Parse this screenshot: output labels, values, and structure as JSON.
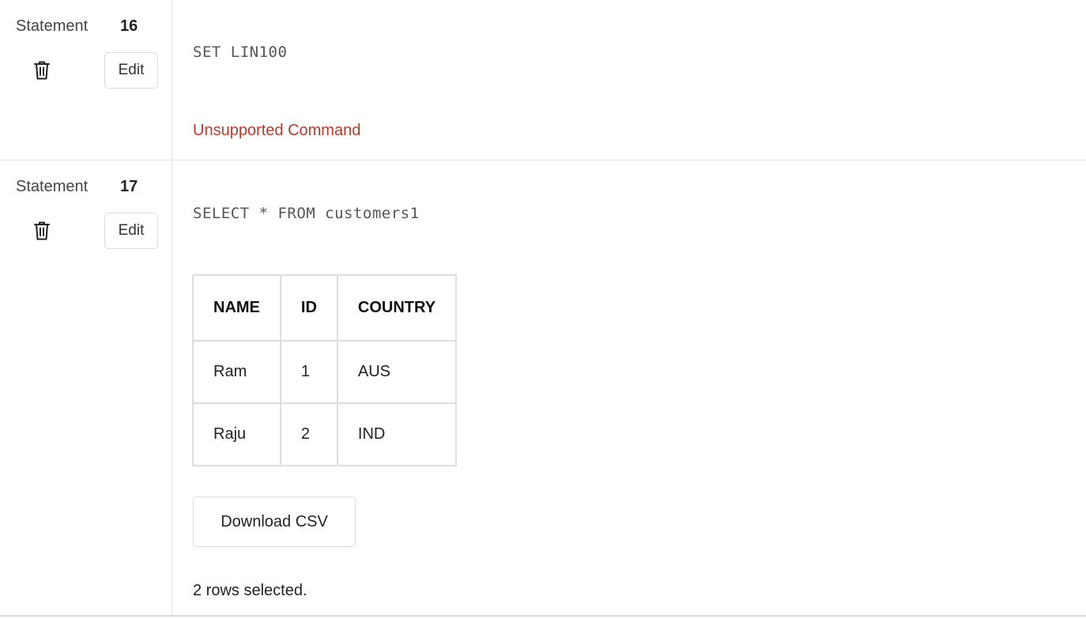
{
  "statements": [
    {
      "label": "Statement",
      "number": "16",
      "edit_label": "Edit",
      "code": "SET LIN100",
      "error": "Unsupported Command"
    },
    {
      "label": "Statement",
      "number": "17",
      "edit_label": "Edit",
      "code": "SELECT * FROM customers1",
      "table": {
        "headers": [
          "NAME",
          "ID",
          "COUNTRY"
        ],
        "rows": [
          [
            "Ram",
            "1",
            "AUS"
          ],
          [
            "Raju",
            "2",
            "IND"
          ]
        ]
      },
      "download_label": "Download CSV",
      "result_message": "2 rows selected."
    }
  ],
  "colors": {
    "error": "#c0392b",
    "border": "#e3e3e3"
  },
  "icons": {
    "delete": "trash-icon"
  }
}
